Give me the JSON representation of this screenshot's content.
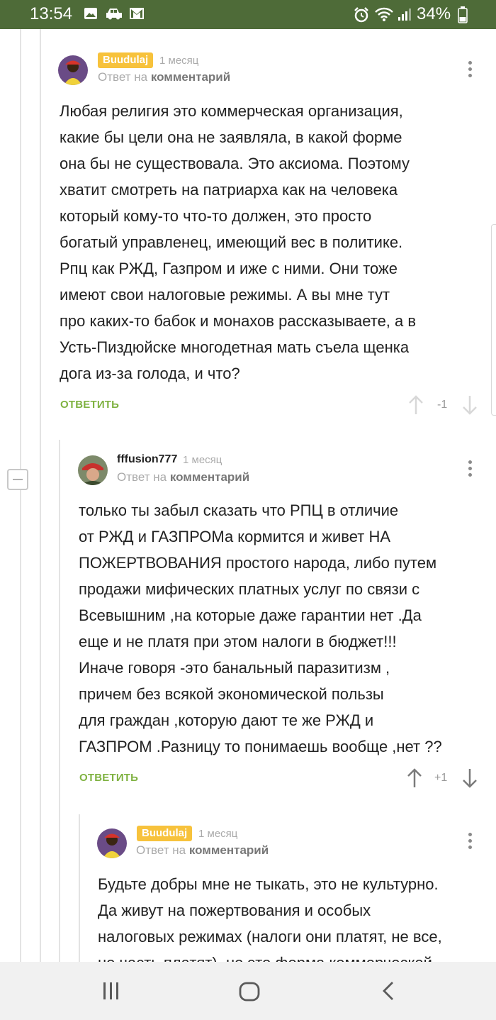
{
  "status_bar": {
    "time": "13:54",
    "battery_percent": "34%",
    "icons": [
      "image-icon",
      "car-icon",
      "gmail-icon",
      "alarm-icon",
      "wifi-icon",
      "signal-icon",
      "battery-icon"
    ]
  },
  "comments": [
    {
      "author": "Buudulaj",
      "author_badge": true,
      "time": "1 месяц",
      "reply_prefix": "Ответ на",
      "reply_target": "комментарий",
      "text": "Любая религия это коммерческая организация,\nкакие бы цели она не заявляла, в какой форме\nона бы не существовала. Это аксиома. Поэтому\nхватит смотреть на патриарха как на человека\nкоторый кому-то что-то должен, это просто\nбогатый управленец, имеющий вес в политике.\nРпц как РЖД, Газпром и иже с ними. Они тоже\nимеют свои налоговые режимы. А вы мне тут\nпро каких-то бабок и монахов рассказываете, а в\nУсть-Пиздюйске многодетная мать съела щенка\nдога из-за голода, и что?",
      "reply_label": "ОТВЕТИТЬ",
      "score": "-1"
    },
    {
      "author": "fffusion777",
      "author_badge": false,
      "time": "1 месяц",
      "reply_prefix": "Ответ на",
      "reply_target": "комментарий",
      "text": "только ты забыл сказать что РПЦ в отличие\nот РЖД и ГАЗПРОМа кормится и живет НА\nПОЖЕРТВОВАНИЯ простого народа, либо путем\nпродажи мифических платных услуг по связи с\nВсевышним ,на которые даже гарантии нет .Да\nеще и не платя при этом налоги в бюджет!!!\nИначе говоря -это банальный паразитизм ,\nпричем без всякой экономической пользы\nдля граждан ,которую дают те же РЖД и\nГАЗПРОМ .Разницу то понимаешь вообще ,нет ??",
      "reply_label": "ОТВЕТИТЬ",
      "score": "+1"
    },
    {
      "author": "Buudulaj",
      "author_badge": true,
      "time": "1 месяц",
      "reply_prefix": "Ответ на",
      "reply_target": "комментарий",
      "text": "Будьте добры мне не тыкать, это не культурно.\nДа живут на пожертвования и особых\nналоговых режимах (налоги они платят, не все,\nно часть платят), но это форма коммерческой"
    }
  ],
  "nav": {
    "buttons": [
      "recents-button",
      "home-button",
      "back-button"
    ]
  }
}
